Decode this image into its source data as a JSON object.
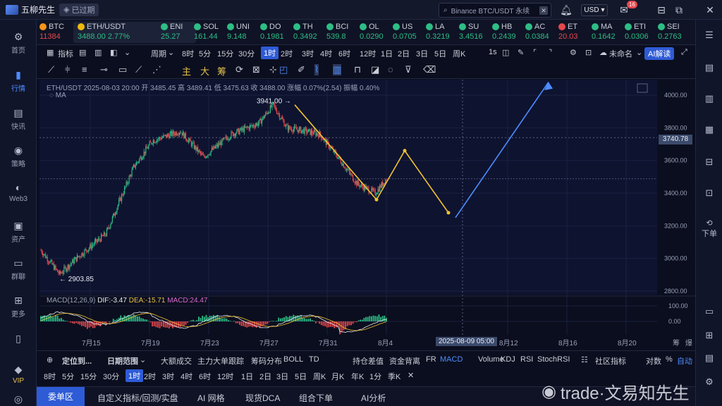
{
  "app": {
    "title": "五柳先生",
    "status_badge": "已过期"
  },
  "search": {
    "placeholder": "Binance BTC/USDT 永续"
  },
  "header": {
    "currency": "USD",
    "notification_count": "16"
  },
  "leftnav": [
    {
      "label": "首页",
      "icon": "home-icon"
    },
    {
      "label": "行情",
      "icon": "chart-bars-icon",
      "active": true
    },
    {
      "label": "快讯",
      "icon": "news-icon"
    },
    {
      "label": "策略",
      "icon": "robot-icon"
    },
    {
      "label": "Web3",
      "icon": "web3-icon"
    },
    {
      "label": "资产",
      "icon": "wallet-icon"
    },
    {
      "label": "群聊",
      "icon": "chat-icon"
    },
    {
      "label": "更多",
      "icon": "grid-icon"
    },
    {
      "label": "",
      "icon": "phone-icon"
    },
    {
      "label": "VIP",
      "icon": "vip-icon"
    }
  ],
  "ticker": [
    {
      "name": "BTC",
      "value": "11384",
      "dir": "dn",
      "color": "#f7931a"
    },
    {
      "name": "ETH/USDT",
      "value": "3488.00  2.77%",
      "dir": "up",
      "color": "#f0b90b",
      "selected": true
    },
    {
      "name": "ENI",
      "value": "25.27",
      "dir": "up",
      "color": "#2ebd85"
    },
    {
      "name": "SOL",
      "value": "161.44",
      "dir": "up",
      "color": "#2ebd85"
    },
    {
      "name": "UNI",
      "value": "9.148",
      "dir": "up",
      "color": "#2ebd85"
    },
    {
      "name": "DO",
      "value": "0.1981",
      "dir": "up",
      "color": "#2ebd85"
    },
    {
      "name": "TH",
      "value": "0.3492",
      "dir": "up",
      "color": "#2ebd85"
    },
    {
      "name": "BCI",
      "value": "539.8",
      "dir": "up",
      "color": "#2ebd85"
    },
    {
      "name": "OL",
      "value": "0.0290",
      "dir": "up",
      "color": "#2ebd85"
    },
    {
      "name": "US",
      "value": "0.0705",
      "dir": "up",
      "color": "#2ebd85"
    },
    {
      "name": "LA",
      "value": "0.3219",
      "dir": "up",
      "color": "#2ebd85"
    },
    {
      "name": "SU",
      "value": "3.4516",
      "dir": "up",
      "color": "#2ebd85"
    },
    {
      "name": "HB",
      "value": "0.2439",
      "dir": "up",
      "color": "#2ebd85"
    },
    {
      "name": "AC",
      "value": "0.0384",
      "dir": "up",
      "color": "#2ebd85"
    },
    {
      "name": "ET",
      "value": "20.03",
      "dir": "dn",
      "color": "#e5484d"
    },
    {
      "name": "MA",
      "value": "0.1642",
      "dir": "up",
      "color": "#2ebd85"
    },
    {
      "name": "ETI",
      "value": "0.0306",
      "dir": "up",
      "color": "#2ebd85"
    },
    {
      "name": "SEI",
      "value": "0.2763",
      "dir": "up",
      "color": "#2ebd85"
    }
  ],
  "toolbar": {
    "indicators": "指标",
    "period": "周期",
    "timeframes": [
      "8时",
      "5分",
      "15分",
      "30分",
      "1时",
      "2时",
      "3时",
      "4时",
      "6时",
      "12时",
      "1日",
      "2日",
      "3日",
      "5日",
      "周K"
    ],
    "active_timeframe": "1时",
    "seconds": "1s",
    "layout_name": "未命名",
    "ai_button": "AI解读"
  },
  "drawing": {
    "tools": [
      "主",
      "大",
      "筹"
    ]
  },
  "chart": {
    "info": "ETH/USDT  2025-08-03 20:00  开 3485.45  高 3489.41  低 3475.63  收 3488.00  涨幅 0.07%(2.54)  振幅 0.40%",
    "ma_label": "MA",
    "high_label": "3941.00 →",
    "low_label": "← 2903.85",
    "current_price": "3740.78",
    "y_ticks": [
      "4000.00",
      "3800.00",
      "3600.00",
      "3400.00",
      "3200.00",
      "3000.00",
      "2800.00"
    ],
    "macd_label": "MACD(12,26,9)",
    "dif": "DIF:-3.47",
    "dea": "DEA:-15.71",
    "macd": "MACD:24.47",
    "macd_ticks": [
      "100.00",
      "0.00"
    ],
    "x_ticks": [
      "7月15",
      "7月19",
      "7月23",
      "7月27",
      "7月31",
      "8月4",
      "8月12",
      "8月16",
      "8月20"
    ],
    "crosshair_time": "2025-08-09 05:00",
    "right_labels": [
      "筹",
      "爆"
    ]
  },
  "chart_data": {
    "type": "candlestick",
    "symbol": "ETH/USDT",
    "interval": "1h",
    "x_range": [
      "7月13",
      "8月22"
    ],
    "ylim": [
      2800,
      4000
    ],
    "marked_high": 3941.0,
    "marked_low": 2903.85,
    "last_close": 3488.0,
    "projection_yellow": [
      [
        3941,
        "8月1"
      ],
      [
        3360,
        "8月3"
      ],
      [
        3660,
        "8月4"
      ],
      [
        3280,
        "8月7"
      ]
    ],
    "projection_blue": [
      [
        3280,
        "8月8"
      ],
      [
        4080,
        "8月16"
      ]
    ],
    "indicator": "MACD(12,26,9)",
    "macd_values": {
      "DIF": -3.47,
      "DEA": -15.71,
      "MACD": 24.47
    }
  },
  "indicator_bar": {
    "locate": "定位到...",
    "date_range": "日期范围",
    "items": [
      "大额成交",
      "主力大单跟踪",
      "筹码分布",
      "BOLL",
      "TD"
    ],
    "items2": [
      "持仓差值",
      "资金背离",
      "FR",
      "MACD",
      "Volume",
      "KDJ",
      "RSI",
      "StochRSI"
    ],
    "active": "MACD",
    "community": "社区指标",
    "log": "对数",
    "pct": "%",
    "auto": "自动"
  },
  "tf2": {
    "items": [
      "8时",
      "5分",
      "15分",
      "30分",
      "1时",
      "2时",
      "3时",
      "4时",
      "6时",
      "12时",
      "1日",
      "2日",
      "3日",
      "5日",
      "周K",
      "月K",
      "年K",
      "1分",
      "季K"
    ],
    "active": "1时"
  },
  "bottom_tabs": [
    "委单区",
    "自定义指标/回测/实盘",
    "AI 网格",
    "现货DCA",
    "组合下单",
    "AI分析"
  ],
  "watermark": "trade·文易知先生",
  "rightbar": {
    "down_label": "下单"
  }
}
